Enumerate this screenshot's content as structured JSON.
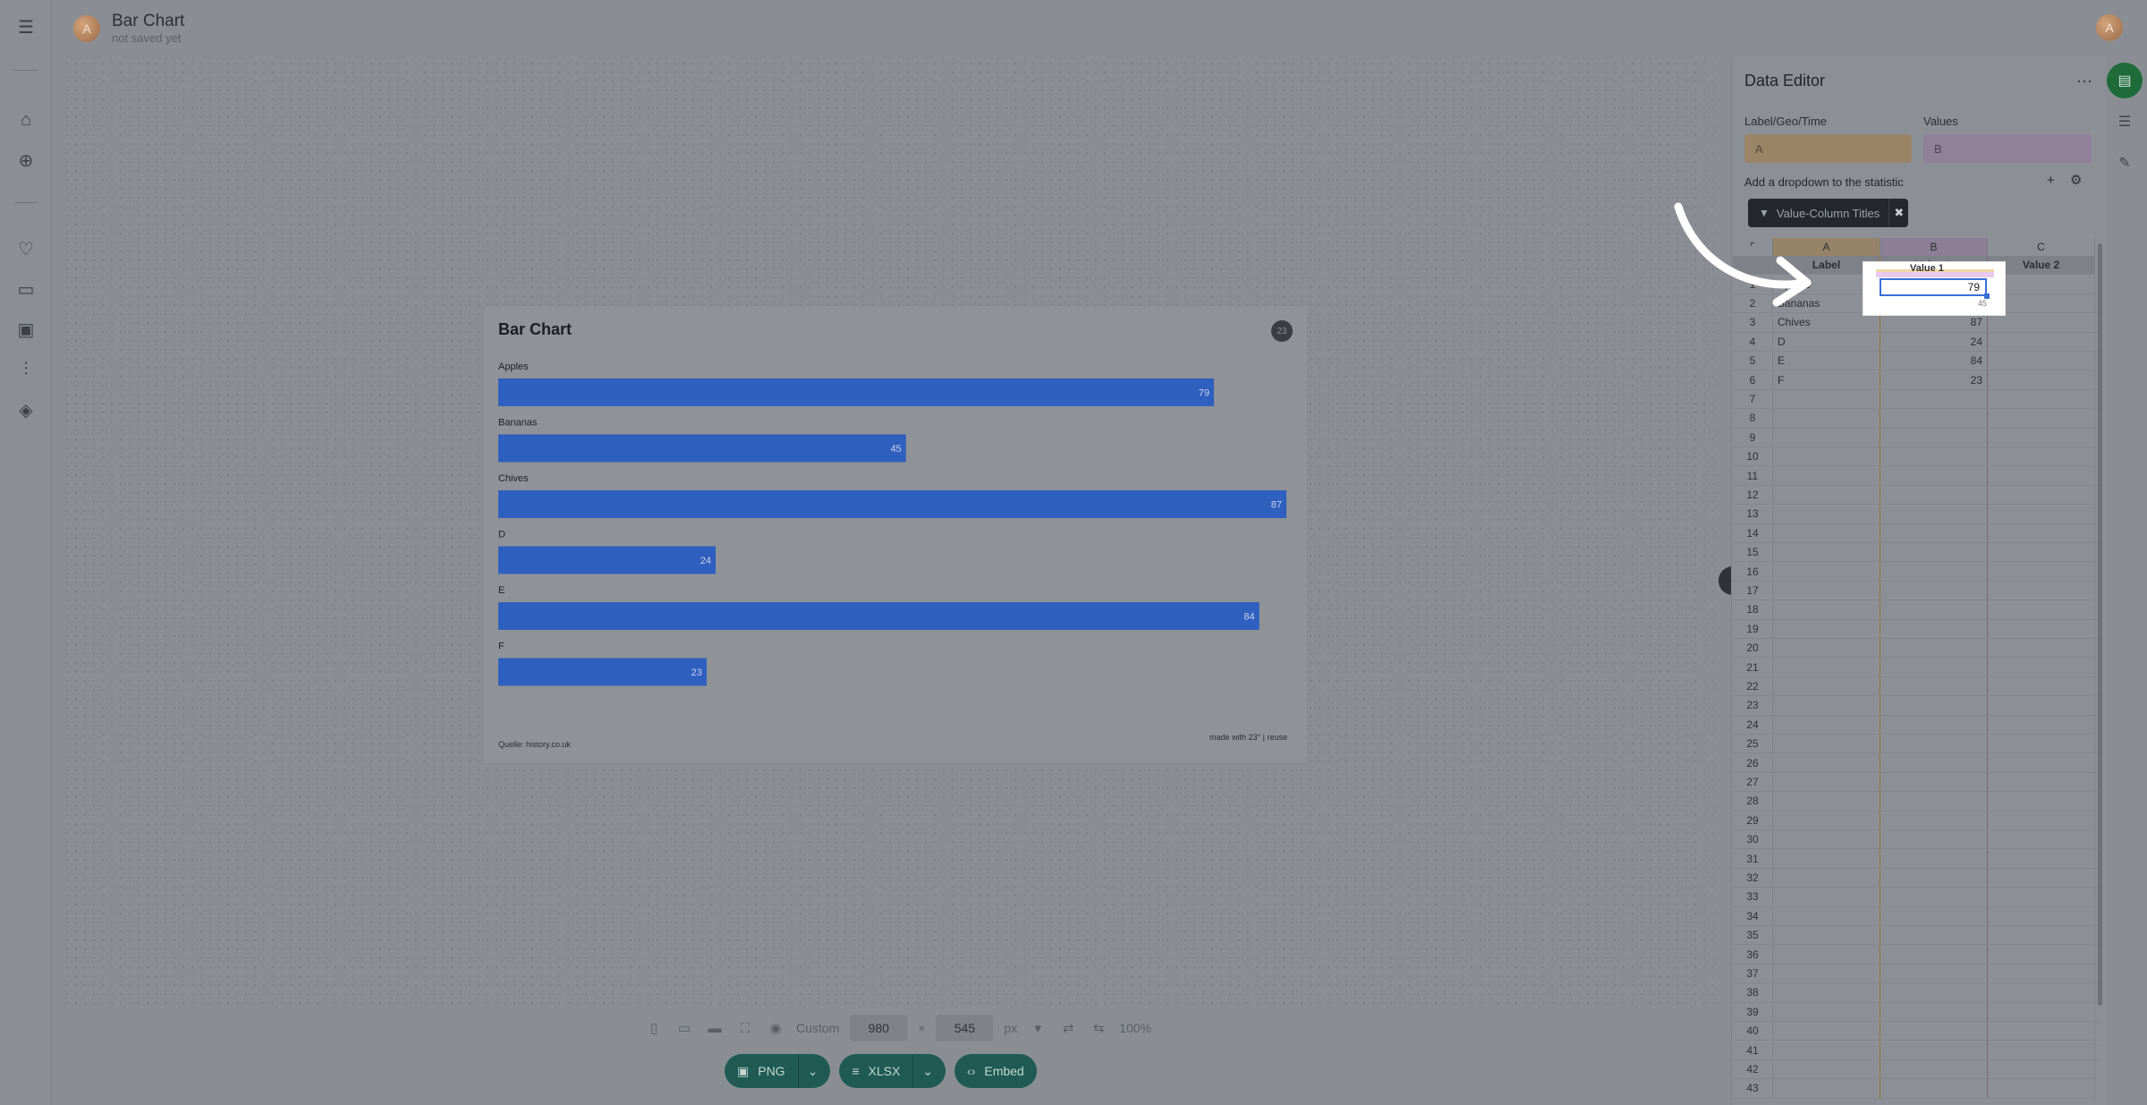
{
  "header": {
    "logo_initial": "A",
    "title": "Bar Chart",
    "subtitle": "not saved yet",
    "user_initial": "A"
  },
  "rail": {
    "icons": [
      "menu-icon",
      "home-icon",
      "add-icon",
      "heart-icon",
      "folder-icon",
      "image-icon",
      "sliders-icon",
      "layers-icon"
    ]
  },
  "chart": {
    "title": "Bar Chart",
    "source": "Quelle: history.co.uk",
    "made_with": "made with 23° | reuse",
    "logo_text": "23"
  },
  "chart_data": {
    "type": "bar",
    "orientation": "horizontal",
    "title": "Bar Chart",
    "categories": [
      "Apples",
      "Bananas",
      "Chives",
      "D",
      "E",
      "F"
    ],
    "values": [
      79,
      45,
      87,
      24,
      84,
      23
    ],
    "xlim": [
      0,
      87
    ],
    "bar_color": "#2f5fbf",
    "grid": false,
    "data_labels": true
  },
  "toolbar": {
    "preset": "Custom",
    "width": "980",
    "height": "545",
    "times": "×",
    "unit": "px",
    "zoom": "100%",
    "png_label": "PNG",
    "xlsx_label": "XLSX",
    "embed_label": "Embed"
  },
  "editor": {
    "title": "Data Editor",
    "more": "···",
    "label_geo_time": "Label/Geo/Time",
    "values_label": "Values",
    "label_col": "A",
    "values_col": "B",
    "dropdown_text": "Add a dropdown to the statistic",
    "plus": "+",
    "filter_chip": "Value-Column Titles",
    "filter_close": "✖"
  },
  "sheet": {
    "columns": [
      "A",
      "B",
      "C"
    ],
    "header_row": [
      "Label",
      "Value 1",
      "Value 2"
    ],
    "rows": [
      [
        "1",
        "Apples",
        "79",
        ""
      ],
      [
        "2",
        "Bananas",
        "45",
        ""
      ],
      [
        "3",
        "Chives",
        "87",
        ""
      ],
      [
        "4",
        "D",
        "24",
        ""
      ],
      [
        "5",
        "E",
        "84",
        ""
      ],
      [
        "6",
        "F",
        "23",
        ""
      ],
      [
        "7",
        "",
        "",
        ""
      ],
      [
        "8",
        "",
        "",
        ""
      ],
      [
        "9",
        "",
        "",
        ""
      ],
      [
        "10",
        "",
        "",
        ""
      ],
      [
        "11",
        "",
        "",
        ""
      ],
      [
        "12",
        "",
        "",
        ""
      ],
      [
        "13",
        "",
        "",
        ""
      ],
      [
        "14",
        "",
        "",
        ""
      ],
      [
        "15",
        "",
        "",
        ""
      ],
      [
        "16",
        "",
        "",
        ""
      ],
      [
        "17",
        "",
        "",
        ""
      ],
      [
        "18",
        "",
        "",
        ""
      ],
      [
        "19",
        "",
        "",
        ""
      ],
      [
        "20",
        "",
        "",
        ""
      ],
      [
        "21",
        "",
        "",
        ""
      ],
      [
        "22",
        "",
        "",
        ""
      ],
      [
        "23",
        "",
        "",
        ""
      ],
      [
        "24",
        "",
        "",
        ""
      ],
      [
        "25",
        "",
        "",
        ""
      ],
      [
        "26",
        "",
        "",
        ""
      ],
      [
        "27",
        "",
        "",
        ""
      ],
      [
        "28",
        "",
        "",
        ""
      ],
      [
        "29",
        "",
        "",
        ""
      ],
      [
        "30",
        "",
        "",
        ""
      ],
      [
        "31",
        "",
        "",
        ""
      ],
      [
        "32",
        "",
        "",
        ""
      ],
      [
        "33",
        "",
        "",
        ""
      ],
      [
        "34",
        "",
        "",
        ""
      ],
      [
        "35",
        "",
        "",
        ""
      ],
      [
        "36",
        "",
        "",
        ""
      ],
      [
        "37",
        "",
        "",
        ""
      ],
      [
        "38",
        "",
        "",
        ""
      ],
      [
        "39",
        "",
        "",
        ""
      ],
      [
        "40",
        "",
        "",
        ""
      ],
      [
        "41",
        "",
        "",
        ""
      ],
      [
        "42",
        "",
        "",
        ""
      ],
      [
        "43",
        "",
        "",
        ""
      ]
    ],
    "selected_value": "79"
  },
  "colors": {
    "accent_save": "#1f6b3a",
    "export_button": "#1f5b53",
    "selection": "#3b6fd9"
  }
}
